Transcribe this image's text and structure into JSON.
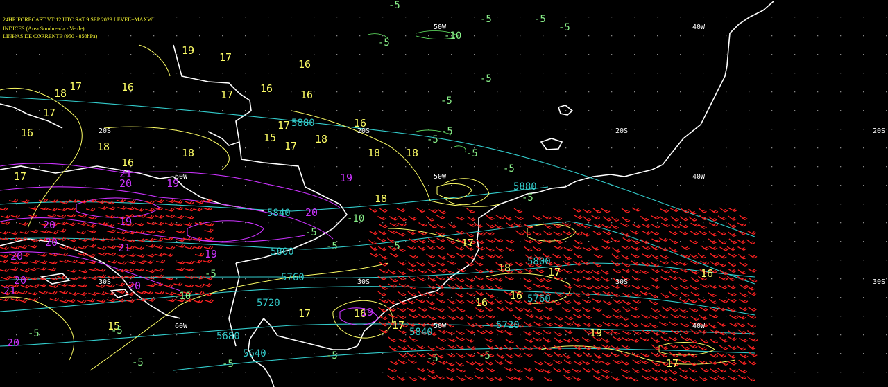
{
  "header": {
    "line1": "24HR FORECAST   VT 12 UTC SAT  9 SEP 2023    LEVEL=MAXW",
    "line2": "INDICES (Area Sombreada - Verde)",
    "line3": "LINHAS DE CORRENTE (950 - 850hPa)"
  },
  "colors": {
    "background": "#000000",
    "coastline": "#ffffff",
    "header": "#ffff33",
    "contour_yellow": "#ffff66",
    "contour_magenta": "#cc33ff",
    "contour_cyan": "#33cccc",
    "wind_barbs": "#ff2222",
    "grid_dots": "#888888"
  },
  "grid_labels": {
    "lon_60w": "60W",
    "lon_50w": "50W",
    "lon_40w": "40W",
    "lat_20s": "20S",
    "lat_30s": "30S"
  },
  "labels_yellow": [
    "19",
    "17",
    "16",
    "17",
    "16",
    "17",
    "16",
    "18",
    "16",
    "17",
    "16",
    "17",
    "18",
    "18",
    "18",
    "16",
    "18",
    "15",
    "17",
    "18",
    "16",
    "17",
    "18",
    "17",
    "18",
    "17",
    "16",
    "16",
    "17",
    "15",
    "17",
    "16",
    "19",
    "17",
    "16"
  ],
  "labels_magenta": [
    "20",
    "21",
    "19",
    "19",
    "19",
    "21",
    "20",
    "19",
    "20",
    "21",
    "20",
    "20",
    "20",
    "20",
    "19",
    "20"
  ],
  "labels_cyan": [
    "5880",
    "5840",
    "5800",
    "5760",
    "5720",
    "5680",
    "5640",
    "5880",
    "5800",
    "5760",
    "5720",
    "5840"
  ],
  "labels_green": [
    "-5",
    "-5",
    "-5",
    "-5",
    "-5",
    "-5",
    "-5",
    "-5",
    "-5",
    "-5",
    "-10",
    "-5",
    "-5",
    "-5",
    "-5",
    "-5",
    "-5",
    "-10",
    "-5",
    "-5",
    "-5",
    "-5",
    "-5",
    "-5",
    "-10",
    "-5"
  ]
}
